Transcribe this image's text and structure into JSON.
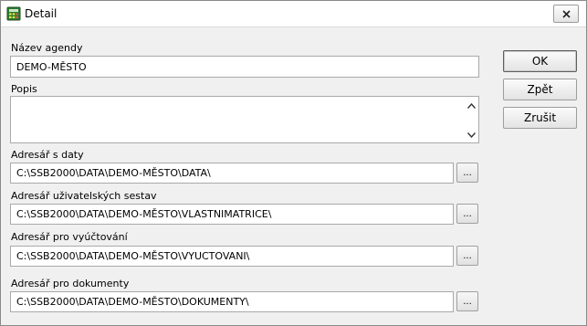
{
  "window": {
    "title": "Detail",
    "app_icon": "calculator-icon",
    "close_icon": "close-icon"
  },
  "fields": {
    "agenda_name": {
      "label": "Název agendy",
      "value": "DEMO-MĚSTO"
    },
    "description": {
      "label": "Popis",
      "value": ""
    },
    "data_dir": {
      "label": "Adresář s daty",
      "value": "C:\\SSB2000\\DATA\\DEMO-MĚSTO\\DATA\\"
    },
    "reports_dir": {
      "label": "Adresář uživatelských sestav",
      "value": "C:\\SSB2000\\DATA\\DEMO-MĚSTO\\VLASTNIMATRICE\\"
    },
    "billing_dir": {
      "label": "Adresář pro vyúčtování",
      "value": "C:\\SSB2000\\DATA\\DEMO-MĚSTO\\VYUCTOVANI\\"
    },
    "documents_dir": {
      "label": "Adresář pro dokumenty",
      "value": "C:\\SSB2000\\DATA\\DEMO-MĚSTO\\DOKUMENTY\\"
    }
  },
  "browse_label": "...",
  "buttons": {
    "ok": "OK",
    "back": "Zpět",
    "cancel": "Zrušit"
  },
  "colors": {
    "window_bg": "#f0f0f0",
    "title_bar": "#ffffff",
    "field_border": "#a9a9a9"
  }
}
